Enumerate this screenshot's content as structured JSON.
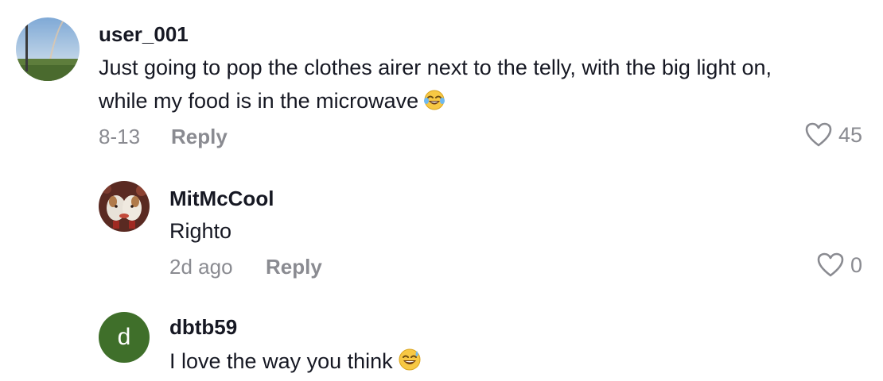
{
  "comments": [
    {
      "username": "user_001",
      "text_line1": "Just going to pop the clothes airer next to the telly, with the big light on,",
      "text_line2": "while my food is in the microwave",
      "emoji": "tears-of-joy-emoji",
      "date": "8-13",
      "reply_label": "Reply",
      "likes": "45"
    },
    {
      "username": "MitMcCool",
      "text": "Righto",
      "date": "2d ago",
      "reply_label": "Reply",
      "likes": "0"
    },
    {
      "username": "dbtb59",
      "avatar_letter": "d",
      "avatar_color": "#3f6f2a",
      "text": "I love the way you think",
      "emoji": "grinning-sweat-emoji"
    }
  ],
  "icons": {
    "like": "heart-outline-icon"
  }
}
